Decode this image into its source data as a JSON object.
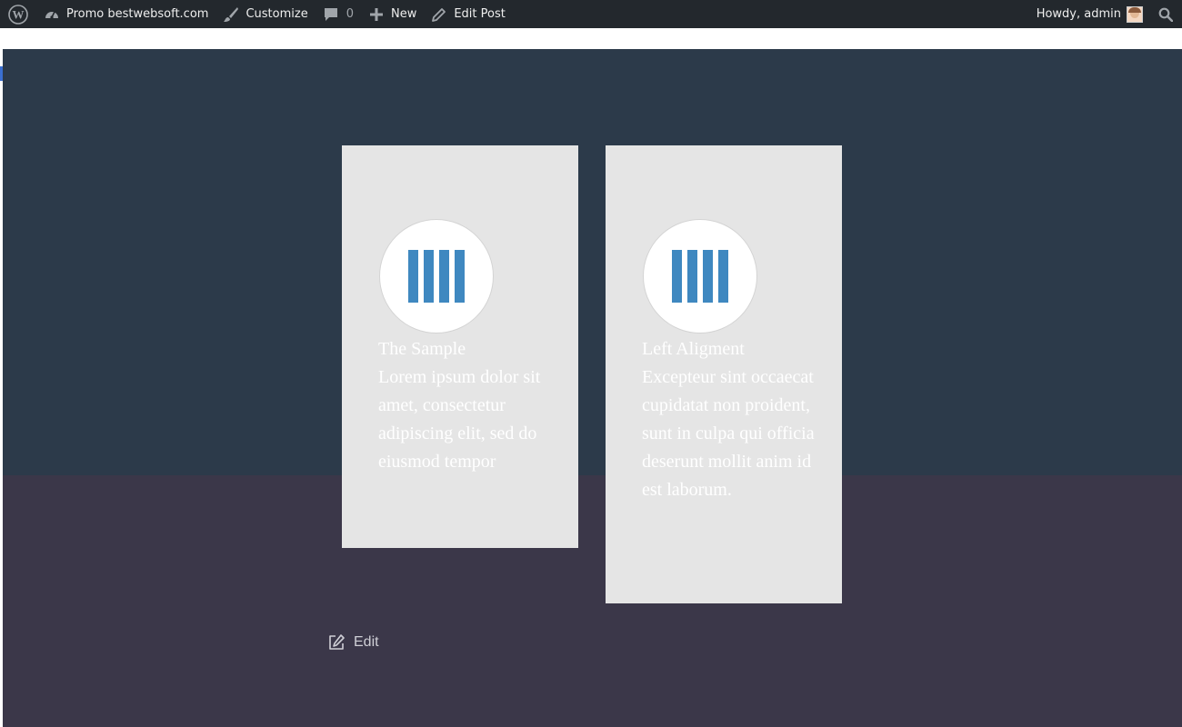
{
  "adminbar": {
    "site_name": "Promo bestwebsoft.com",
    "customize_label": "Customize",
    "comments_count": "0",
    "new_label": "New",
    "edit_post_label": "Edit Post",
    "greeting": "Howdy, admin"
  },
  "cards": [
    {
      "title": "The Sample",
      "body": "Lorem ipsum dolor sit amet, consectetur adipiscing elit, sed do eiusmod tempor"
    },
    {
      "title": "Left Aligment",
      "body": "Excepteur sint occaecat cupidatat non proident, sunt in culpa qui officia deserunt mollit anim id est laborum."
    }
  ],
  "edit_label": "Edit",
  "icons": {
    "wordpress": "wordpress-logo-icon",
    "dashboard": "dashboard-icon",
    "brush": "brush-icon",
    "comment": "comment-icon",
    "plus": "plus-icon",
    "pencil": "pencil-icon",
    "search": "search-icon",
    "feature": "vertical-bars-icon",
    "edit": "edit-square-icon"
  },
  "colors": {
    "adminbar_bg": "#23282d",
    "hero_bg": "#2c3a4a",
    "lower_bg": "#3b3749",
    "card_bg": "#e5e5e5",
    "accent_blue": "#3f88c0"
  }
}
